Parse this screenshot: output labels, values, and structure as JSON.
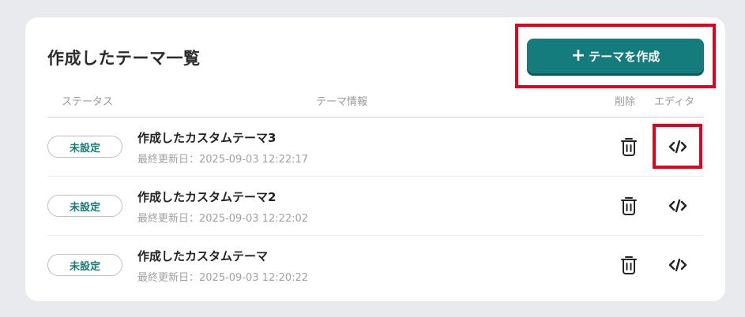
{
  "page": {
    "title": "作成したテーマ一覧",
    "create_button": {
      "plus": "+",
      "label": "テーマを作成"
    }
  },
  "table": {
    "headers": {
      "status": "ステータス",
      "info": "テーマ情報",
      "delete": "削除",
      "editor": "エディタ"
    },
    "rows": [
      {
        "status": "未設定",
        "name": "作成したカスタムテーマ3",
        "updated": "最終更新日：2025-09-03 12:22:17"
      },
      {
        "status": "未設定",
        "name": "作成したカスタムテーマ2",
        "updated": "最終更新日：2025-09-03 12:22:02"
      },
      {
        "status": "未設定",
        "name": "作成したカスタムテーマ",
        "updated": "最終更新日：2025-09-03 12:20:22"
      }
    ]
  },
  "icons": {
    "delete": "trash-icon",
    "editor": "code-icon"
  },
  "colors": {
    "accent": "#147c7c",
    "highlight": "#e3001e",
    "status_text": "#167a75"
  }
}
